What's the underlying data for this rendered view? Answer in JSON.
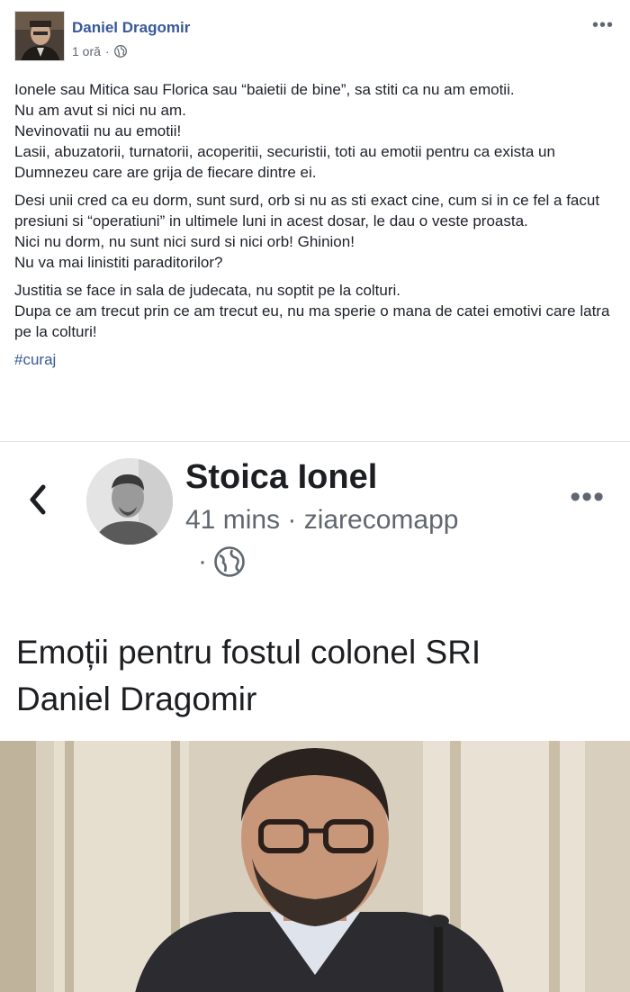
{
  "post": {
    "author": "Daniel Dragomir",
    "time": "1 oră",
    "dot": "·",
    "more": "•••"
  },
  "body": {
    "para1": [
      "Ionele sau Mitica sau Florica sau “baietii de bine”, sa stiti ca nu am emotii.",
      "Nu am avut si nici nu am.",
      "Nevinovatii nu au emotii!",
      "Lasii, abuzatorii, turnatorii, acoperitii, securistii, toti au emotii pentru ca exista un Dumnezeu care are grija de fiecare dintre ei."
    ],
    "para2": [
      "Desi unii cred ca eu dorm, sunt surd, orb si nu as sti exact cine, cum si in ce fel a facut presiuni si “operatiuni” in ultimele luni in acest dosar, le dau o veste proasta.",
      "Nici nu dorm, nu sunt nici surd si nici orb! Ghinion!",
      "Nu va mai linistiti paraditorilor?"
    ],
    "para3": [
      "Justitia se face in sala de judecata, nu soptit pe la colturi.",
      "Dupa ce am trecut prin ce am trecut eu, nu ma sperie o mana de catei emotivi care latra pe la colturi!"
    ],
    "hashtag": "#curaj"
  },
  "shared": {
    "name": "Stoica Ionel",
    "meta": "41 mins · ziarecomapp",
    "dot": "·",
    "more": "•••",
    "headline_line1": "Emoții pentru fostul colonel SRI",
    "headline_line2": "Daniel Dragomir"
  },
  "colors": {
    "link": "#385898",
    "text": "#1d2129",
    "muted": "#606770"
  },
  "icons": {
    "globe": "globe-icon",
    "chevron": "chevron-left-icon",
    "more": "more-icon"
  }
}
